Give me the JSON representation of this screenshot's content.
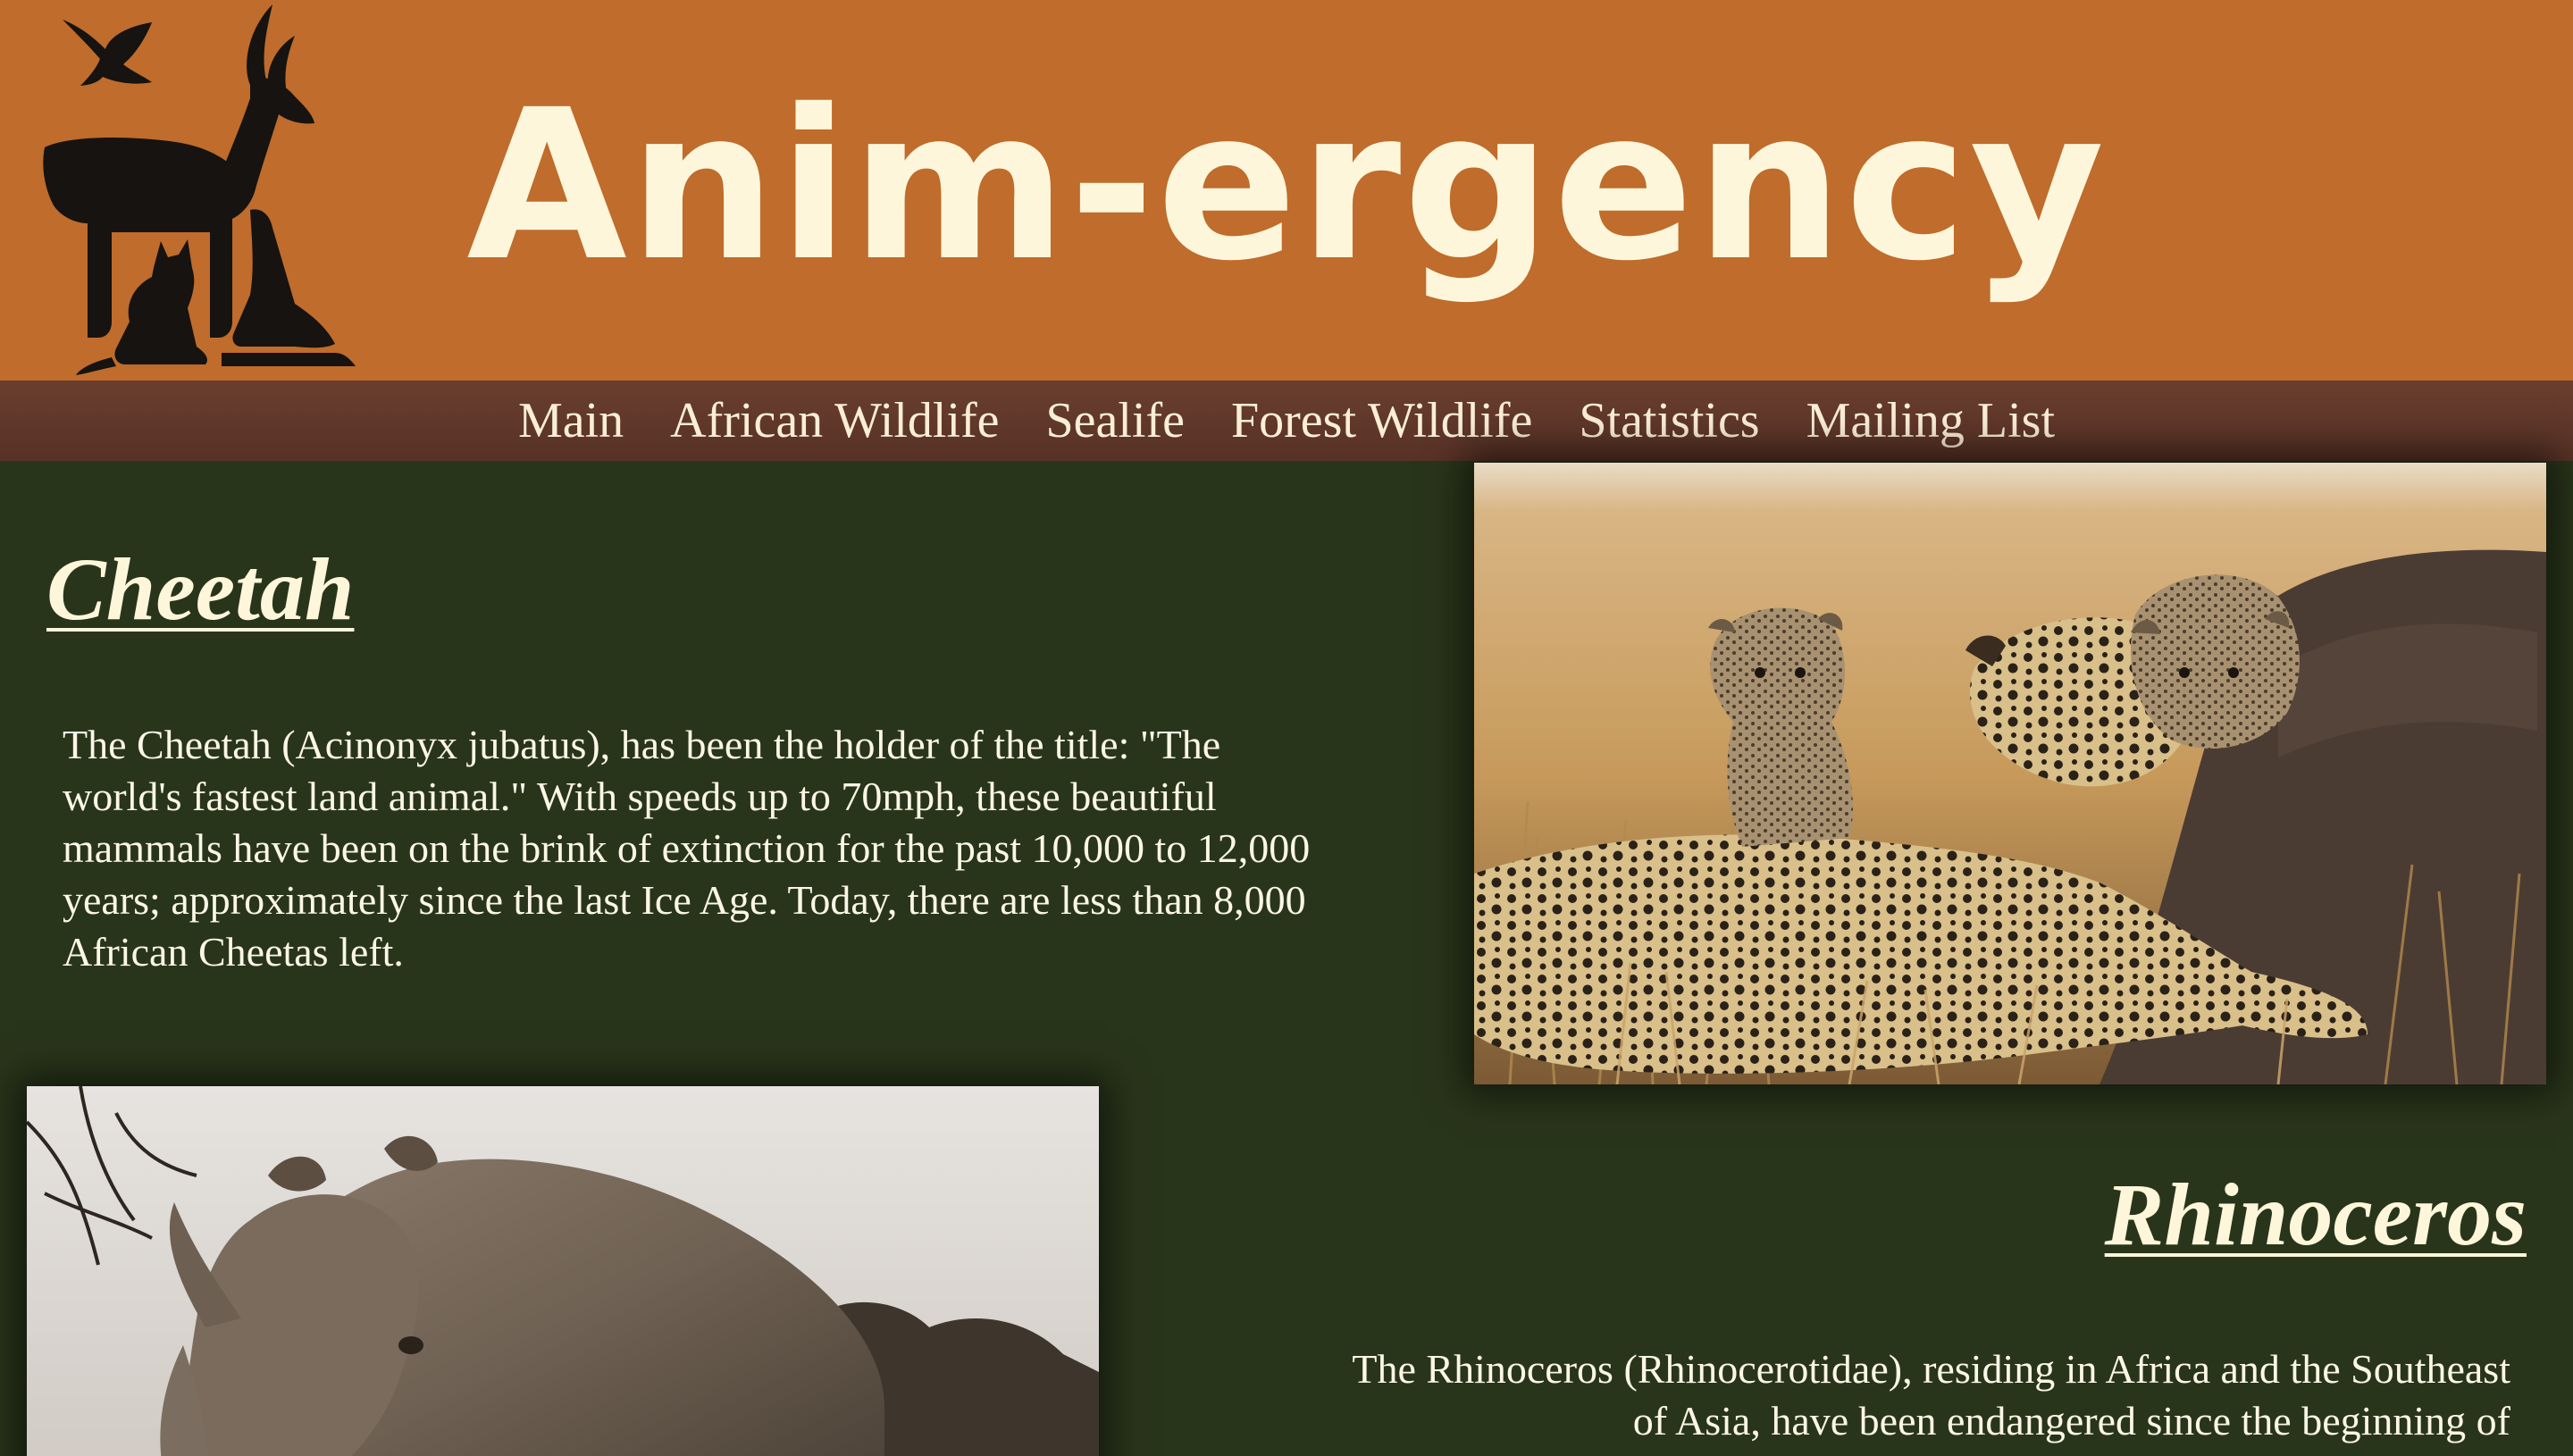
{
  "header": {
    "title": "Anim-ergency"
  },
  "nav": {
    "items": [
      {
        "label": "Main"
      },
      {
        "label": "African Wildlife"
      },
      {
        "label": "Sealife"
      },
      {
        "label": "Forest Wildlife"
      },
      {
        "label": "Statistics"
      },
      {
        "label": "Mailing List"
      }
    ]
  },
  "sections": [
    {
      "title": "Cheetah",
      "text": "The Cheetah (Acinonyx jubatus), has been the holder of the title: \"The world's fastest land animal.\" With speeds up to 70mph, these beautiful mammals have been on the brink of extinction for the past 10,000 to 12,000 years; approximately since the last Ice Age. Today, there are less than 8,000 African Cheetas left."
    },
    {
      "title": "Rhinoceros",
      "text": "The Rhinoceros (Rhinocerotidae), residing in Africa and the Southeast of Asia, have been endangered since the beginning of"
    }
  ],
  "colors": {
    "header_bg": "#bf6c2c",
    "nav_bg": "#5f3729",
    "content_bg": "#29351b",
    "title_text": "#fdf6da"
  },
  "icons": {
    "logo": "animals-silhouette-logo"
  }
}
